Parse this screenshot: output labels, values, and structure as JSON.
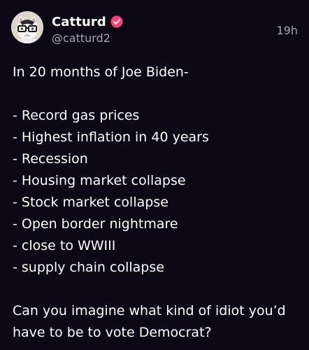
{
  "author": {
    "display_name": "Catturd",
    "handle": "@catturd2",
    "verified": true,
    "verified_badge_color": "#ff3f7a"
  },
  "timestamp": "19h",
  "post": {
    "intro": "In 20 months of Joe Biden-",
    "list": [
      "- Record gas prices",
      "- Highest inflation in 40 years",
      "- Recession",
      "- Housing market collapse",
      "- Stock market collapse",
      "- Open border nightmare",
      "- close to WWIII",
      "- supply chain collapse"
    ],
    "outro_line1": "Can you imagine what kind of idiot you’d",
    "outro_line2": "have to be to vote Democrat?"
  },
  "colors": {
    "background": "#0c0816",
    "text": "#ffffff",
    "muted_text": "#a8a4b2"
  },
  "icons": {
    "avatar": "cat-with-glasses-avatar",
    "verified": "verified-badge-icon"
  }
}
